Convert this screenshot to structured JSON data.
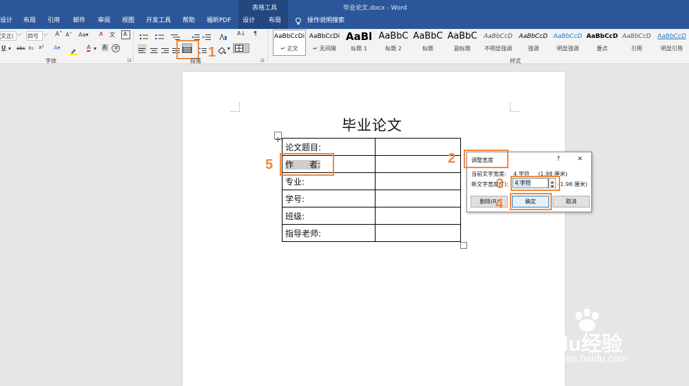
{
  "window": {
    "context_group": "表格工具",
    "title": "毕业论文.docx  -  Word"
  },
  "tabs": [
    "设计",
    "布局",
    "引用",
    "邮件",
    "审阅",
    "视图",
    "开发工具",
    "帮助",
    "福昕PDF",
    "设计",
    "布局"
  ],
  "tell_me": "操作说明搜索",
  "ribbon": {
    "font_group_label": "字体",
    "paragraph_group_label": "段落",
    "styles_group_label": "样式",
    "font_name": "文正(",
    "font_size": "四号",
    "styles": [
      {
        "preview": "AaBbCcDi",
        "name": "↵ 正文"
      },
      {
        "preview": "AaBbCcDi",
        "name": "↵ 无间隔"
      },
      {
        "preview": "AaBl",
        "name": "标题 1"
      },
      {
        "preview": "AaBbC",
        "name": "标题 2"
      },
      {
        "preview": "AaBbC",
        "name": "标题"
      },
      {
        "preview": "AaBbC",
        "name": "副标题"
      },
      {
        "preview": "AaBbCcD",
        "name": "不明显强调"
      },
      {
        "preview": "AaBbCcD",
        "name": "强调"
      },
      {
        "preview": "AaBbCcD",
        "name": "明显强调"
      },
      {
        "preview": "AaBbCcD",
        "name": "要点"
      },
      {
        "preview": "AaBbCcD",
        "name": "引用"
      },
      {
        "preview": "AaBbCcD",
        "name": "明显引用"
      }
    ]
  },
  "document": {
    "title": "毕业论文",
    "rows": [
      {
        "label": "论文题目:"
      },
      {
        "label": "作      者:"
      },
      {
        "label": "专业:"
      },
      {
        "label": "学号:"
      },
      {
        "label": "班级:"
      },
      {
        "label": "指导老师:"
      }
    ]
  },
  "dialog": {
    "title": "调整宽度",
    "help": "?",
    "close": "✕",
    "current_label": "当前文字宽度:",
    "current_value": "4 字符",
    "current_cm": "(1.98 厘米)",
    "new_label": "新文字宽度(T):",
    "new_value": "4 字符",
    "new_cm": "(1.98 厘米)",
    "delete_button": "删除(R)",
    "ok_button": "确定",
    "cancel_button": "取消"
  },
  "annotations": [
    "1",
    "2",
    "3",
    "4",
    "5"
  ],
  "watermark": {
    "brand": "Baidu经验",
    "url": "jingyan.baidu.com"
  },
  "colors": {
    "title_bar": "#2b579a",
    "callout": "#f0883e"
  }
}
